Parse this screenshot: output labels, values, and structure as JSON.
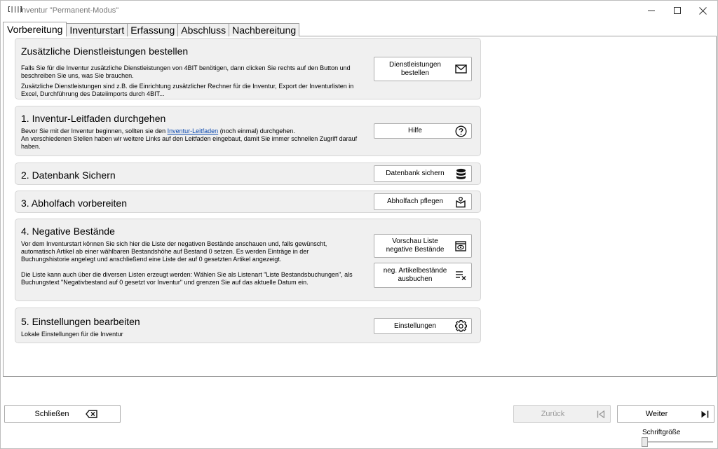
{
  "window": {
    "icon_text": "[|||]",
    "title": "Inventur \"Permanent-Modus\""
  },
  "tabs": [
    {
      "label": "Vorbereitung"
    },
    {
      "label": "Inventurstart"
    },
    {
      "label": "Erfassung"
    },
    {
      "label": "Abschluss"
    },
    {
      "label": "Nachbereitung"
    }
  ],
  "sections": {
    "services": {
      "title": "Zusätzliche Dienstleistungen bestellen",
      "text1": "Falls Sie für die Inventur zusätzliche Dienstleistungen von 4BIT benötigen, dann clicken Sie rechts auf den Button und beschreiben Sie uns, was Sie brauchen.",
      "text2": "Zusätzliche Dienstleistungen sind z.B. die Einrichtung zusätzlicher Rechner für die Inventur, Export der Inventurlisten in Excel, Durchführung des Dateiimports durch 4BIT...",
      "button": "Dienstleistungen bestellen",
      "button_icon": "mail-icon"
    },
    "guide": {
      "title": "1. Inventur-Leitfaden durchgehen",
      "text_before": "Bevor Sie mit der Inventur beginnen, sollten sie den ",
      "link": "Inventur-Leitfaden",
      "text_after": " (noch einmal) durchgehen.",
      "text2": "An verschiedenen Stellen haben wir weitere Links auf den Leitfaden eingebaut, damit Sie immer schnellen Zugriff darauf haben.",
      "button": "Hilfe",
      "button_icon": "help-icon"
    },
    "backup": {
      "title": "2. Datenbank Sichern",
      "button": "Datenbank sichern",
      "button_icon": "database-icon"
    },
    "pickup": {
      "title": "3. Abholfach vorbereiten",
      "button": "Abholfach pflegen",
      "button_icon": "pickup-box-icon"
    },
    "negative": {
      "title": "4. Negative Bestände",
      "text1": "Vor dem Inventurstart können Sie sich hier die Liste der negativen Bestände anschauen und, falls gewünscht, automatisch Artikel ab einer wählbaren Bestandshöhe auf Bestand 0 setzen. Es werden Einträge in der Buchungshistorie angelegt und anschließend eine Liste der auf 0 gesetzten Artikel angezeigt.",
      "text2": "Die Liste kann auch über die diversen Listen erzeugt werden: Wählen Sie als Listenart \"Liste Bestandsbuchungen\", als Buchungstext \"Negativbestand auf 0 gesetzt vor Inventur\" und grenzen Sie auf das aktuelle Datum ein.",
      "button_preview": "Vorschau Liste negative Bestände",
      "button_preview_icon": "preview-icon",
      "button_book": "neg. Artikelbestände ausbuchen",
      "button_book_icon": "list-remove-icon"
    },
    "settings": {
      "title": "5. Einstellungen bearbeiten",
      "text": "Lokale Einstellungen für die Inventur",
      "button": "Einstellungen",
      "button_icon": "gear-icon"
    }
  },
  "footer": {
    "close": "Schließen",
    "back": "Zurück",
    "next": "Weiter",
    "font_size_label": "Schriftgröße",
    "font_size_level": 0
  }
}
